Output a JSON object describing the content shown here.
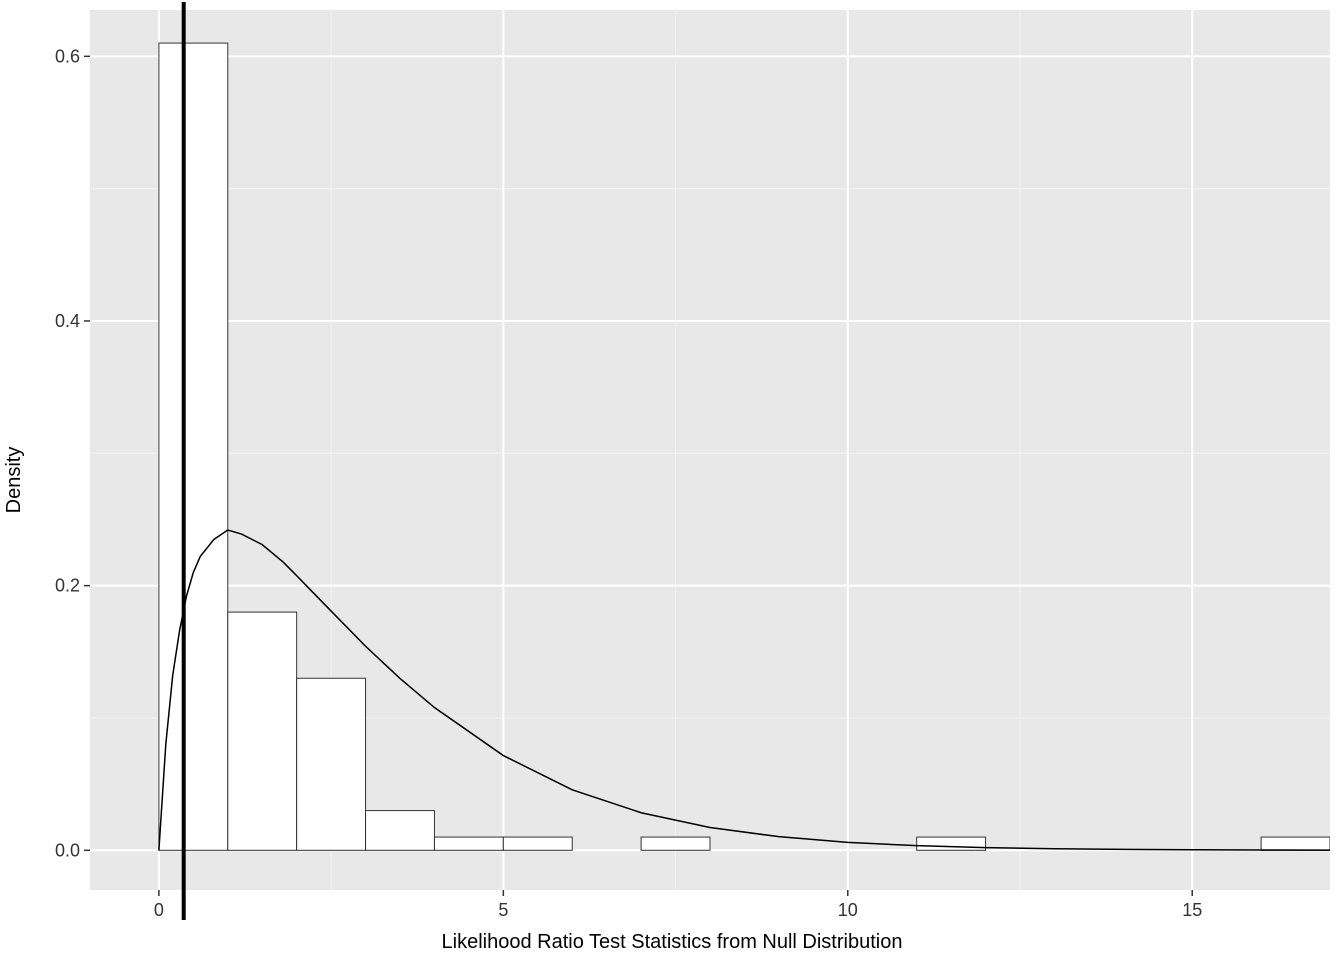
{
  "chart_data": {
    "type": "histogram+line",
    "xlabel": "Likelihood Ratio Test Statistics from Null Distribution",
    "ylabel": "Density",
    "xlim": [
      -1,
      17
    ],
    "ylim": [
      -0.03,
      0.635
    ],
    "x_ticks": [
      0,
      5,
      10,
      15
    ],
    "y_ticks": [
      0.0,
      0.2,
      0.4,
      0.6
    ],
    "x_tick_labels": [
      "0",
      "5",
      "10",
      "15"
    ],
    "y_tick_labels": [
      "0.0",
      "0.2",
      "0.4",
      "0.6"
    ],
    "x_minor_ticks": [
      2.5,
      7.5,
      12.5
    ],
    "y_minor_ticks": [
      0.1,
      0.3,
      0.5
    ],
    "bin_width": 1.0,
    "histogram": [
      {
        "x0": 0,
        "x1": 1,
        "density": 0.61
      },
      {
        "x0": 1,
        "x1": 2,
        "density": 0.18
      },
      {
        "x0": 2,
        "x1": 3,
        "density": 0.13
      },
      {
        "x0": 3,
        "x1": 4,
        "density": 0.03
      },
      {
        "x0": 4,
        "x1": 5,
        "density": 0.01
      },
      {
        "x0": 5,
        "x1": 6,
        "density": 0.01
      },
      {
        "x0": 7,
        "x1": 8,
        "density": 0.01
      },
      {
        "x0": 11,
        "x1": 12,
        "density": 0.01
      },
      {
        "x0": 16,
        "x1": 17,
        "density": 0.01
      }
    ],
    "density_curve": {
      "x": [
        0,
        0.1,
        0.2,
        0.3,
        0.4,
        0.5,
        0.6,
        0.8,
        1,
        1.2,
        1.5,
        1.8,
        2,
        2.5,
        3,
        3.5,
        4,
        5,
        6,
        7,
        8,
        9,
        10,
        11,
        12,
        13,
        14,
        15,
        16,
        17
      ],
      "y": [
        0,
        0.08,
        0.132,
        0.166,
        0.192,
        0.21,
        0.222,
        0.235,
        0.242,
        0.239,
        0.231,
        0.218,
        0.2075,
        0.1808,
        0.1542,
        0.1299,
        0.1079,
        0.0716,
        0.0457,
        0.0284,
        0.0172,
        0.0103,
        0.006,
        0.0035,
        0.002,
        0.0012,
        0.0007,
        0.0004,
        0.0002,
        0.0001
      ]
    },
    "vline_x": 0.36
  }
}
